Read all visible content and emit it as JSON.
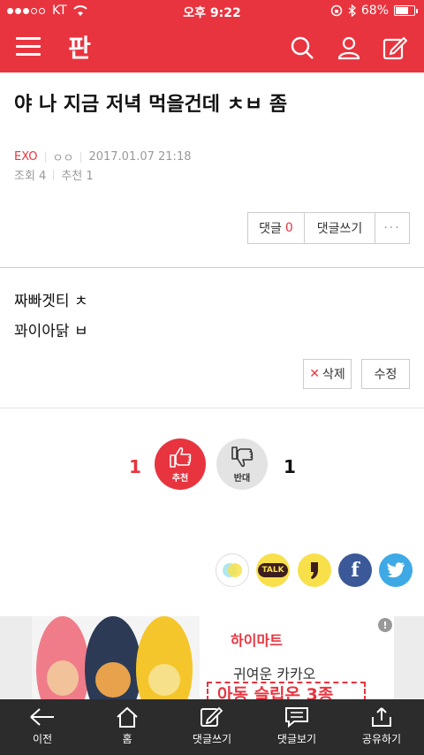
{
  "status": {
    "carrier": "KT",
    "time": "오후 9:22",
    "battery_text": "68%",
    "battery_level": 0.68
  },
  "header": {
    "logo_text": "판"
  },
  "post": {
    "title": "야 나 지금 저녁 먹을건데 ㅊㅂ 좀",
    "category": "EXO",
    "author": "ㅇㅇ",
    "date": "2017.01.07 21:18",
    "views_label": "조회 4",
    "recommend_label": "추천 1",
    "body": [
      "짜빠겟티 ㅊ",
      "꽈이아닭 ㅂ"
    ]
  },
  "comment_buttons": {
    "comments_label": "댓글",
    "comments_count": "0",
    "write_label": "댓글쓰기",
    "more_label": "···"
  },
  "edit_buttons": {
    "delete_label": "삭제",
    "edit_label": "수정"
  },
  "vote": {
    "up_count": "1",
    "up_label": "추천",
    "down_label": "반대",
    "down_count": "1"
  },
  "share": {
    "kakaotalk_label": "TALK"
  },
  "ad": {
    "brand": "하이마트",
    "line1": "귀여운 카카오",
    "line2": "아동 슬립온 3종"
  },
  "bottom_nav": [
    {
      "label": "이전"
    },
    {
      "label": "홈"
    },
    {
      "label": "댓글쓰기"
    },
    {
      "label": "댓글보기"
    },
    {
      "label": "공유하기"
    }
  ],
  "colors": {
    "brand": "#e8343f",
    "dislike_bg": "#e3e3e3",
    "bottom_bar": "#2c2c2c"
  }
}
